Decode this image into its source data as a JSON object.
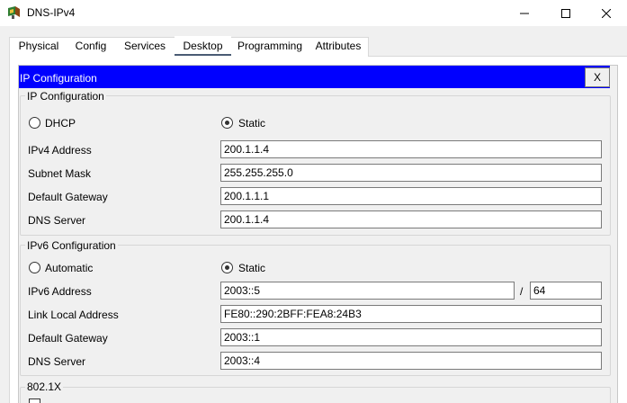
{
  "window": {
    "title": "DNS-IPv4"
  },
  "tabs": [
    {
      "label": "Physical"
    },
    {
      "label": "Config"
    },
    {
      "label": "Services"
    },
    {
      "label": "Desktop"
    },
    {
      "label": "Programming"
    },
    {
      "label": "Attributes"
    }
  ],
  "active_tab": "Desktop",
  "panel": {
    "title": "IP Configuration",
    "close_label": "X"
  },
  "ipv4": {
    "group_title": "IP Configuration",
    "mode_options": [
      "DHCP",
      "Static"
    ],
    "selected_mode": "Static",
    "fields": [
      {
        "label": "IPv4 Address",
        "value": "200.1.1.4"
      },
      {
        "label": "Subnet Mask",
        "value": "255.255.255.0"
      },
      {
        "label": "Default Gateway",
        "value": "200.1.1.1"
      },
      {
        "label": "DNS Server",
        "value": "200.1.1.4"
      }
    ]
  },
  "ipv6": {
    "group_title": "IPv6 Configuration",
    "mode_options": [
      "Automatic",
      "Static"
    ],
    "selected_mode": "Static",
    "address_label": "IPv6 Address",
    "address_value": "2003::5",
    "prefix_separator": "/",
    "prefix_value": "64",
    "fields": [
      {
        "label": "Link Local Address",
        "value": "FE80::290:2BFF:FEA8:24B3"
      },
      {
        "label": "Default Gateway",
        "value": "2003::1"
      },
      {
        "label": "DNS Server",
        "value": "2003::4"
      }
    ]
  },
  "dot1x": {
    "group_title": "802.1X"
  },
  "colors": {
    "header_blue": "#0000ff",
    "active_tab_underline": "#4a5b74"
  },
  "icons": {
    "app": "packet-tracer-server-icon",
    "minimize": "minimize-icon",
    "maximize": "maximize-icon",
    "close": "close-icon"
  }
}
